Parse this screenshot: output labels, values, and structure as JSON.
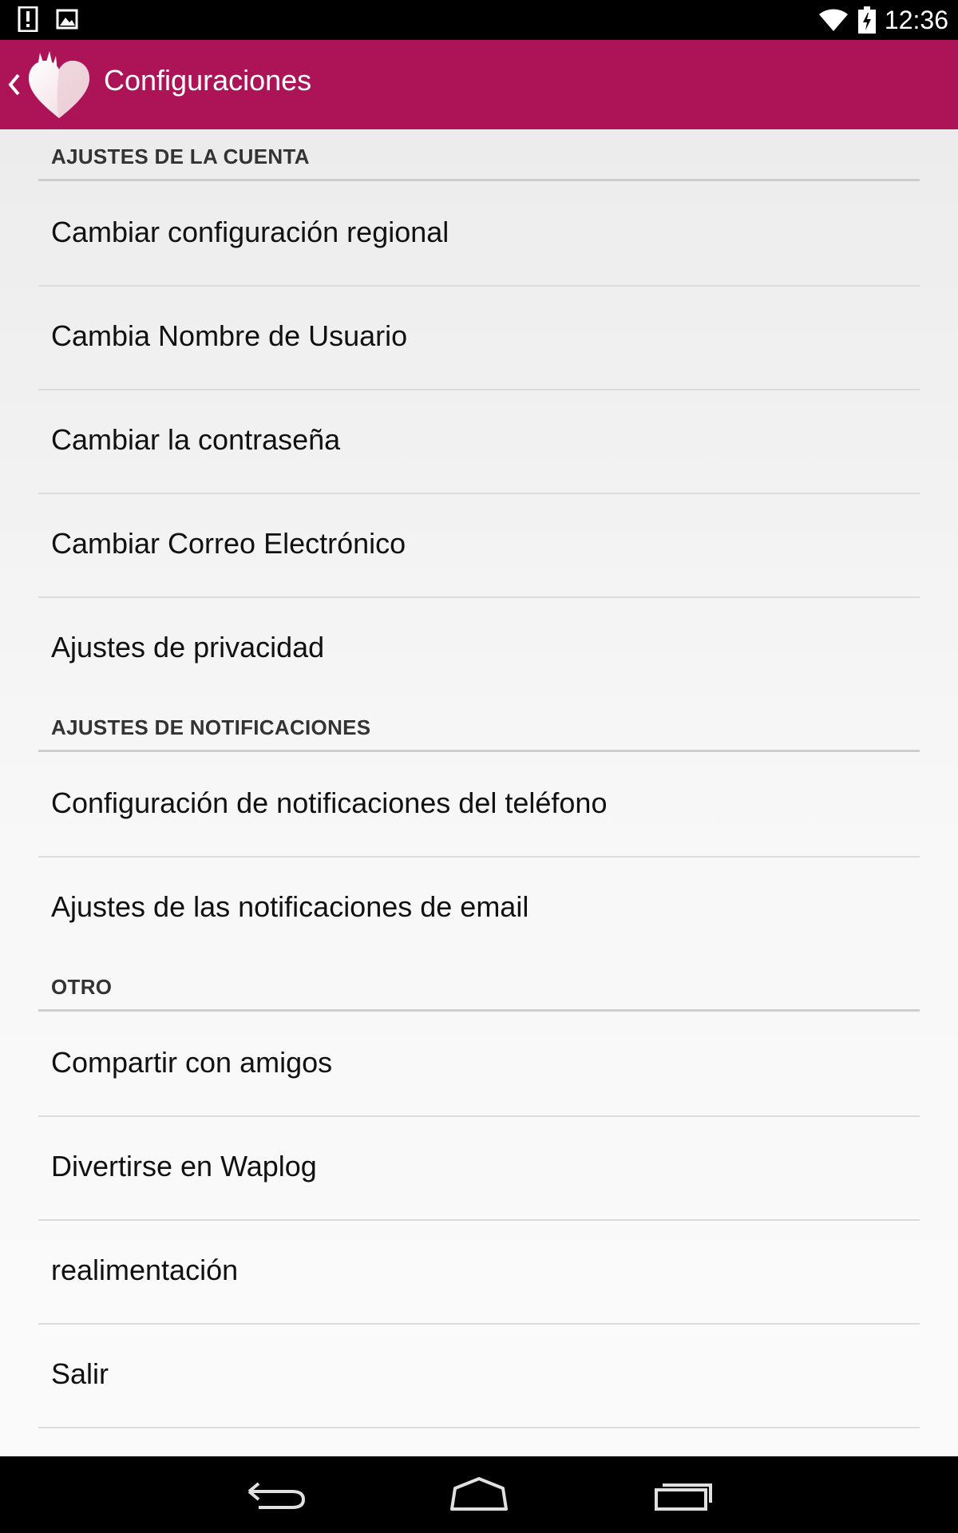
{
  "status_bar": {
    "time": "12:36",
    "icons": [
      "alert-icon",
      "image-icon",
      "wifi-icon",
      "battery-charging-icon"
    ]
  },
  "app_bar": {
    "title": "Configuraciones",
    "back_icon": "chevron-left-icon",
    "logo": "heart-flame-logo",
    "color": "#ad1457"
  },
  "sections": [
    {
      "title": "AJUSTES DE LA CUENTA",
      "items": [
        "Cambiar configuración regional",
        "Cambia Nombre de Usuario",
        "Cambiar la contraseña",
        "Cambiar Correo Electrónico",
        "Ajustes de privacidad"
      ]
    },
    {
      "title": "AJUSTES DE NOTIFICACIONES",
      "items": [
        "Configuración de notificaciones del teléfono",
        "Ajustes de las notificaciones de email"
      ]
    },
    {
      "title": "OTRO",
      "items": [
        "Compartir con amigos",
        "Divertirse en Waplog",
        "realimentación",
        "Salir"
      ]
    }
  ],
  "nav_bar": {
    "icons": [
      "back-icon",
      "home-icon",
      "recent-apps-icon"
    ]
  }
}
